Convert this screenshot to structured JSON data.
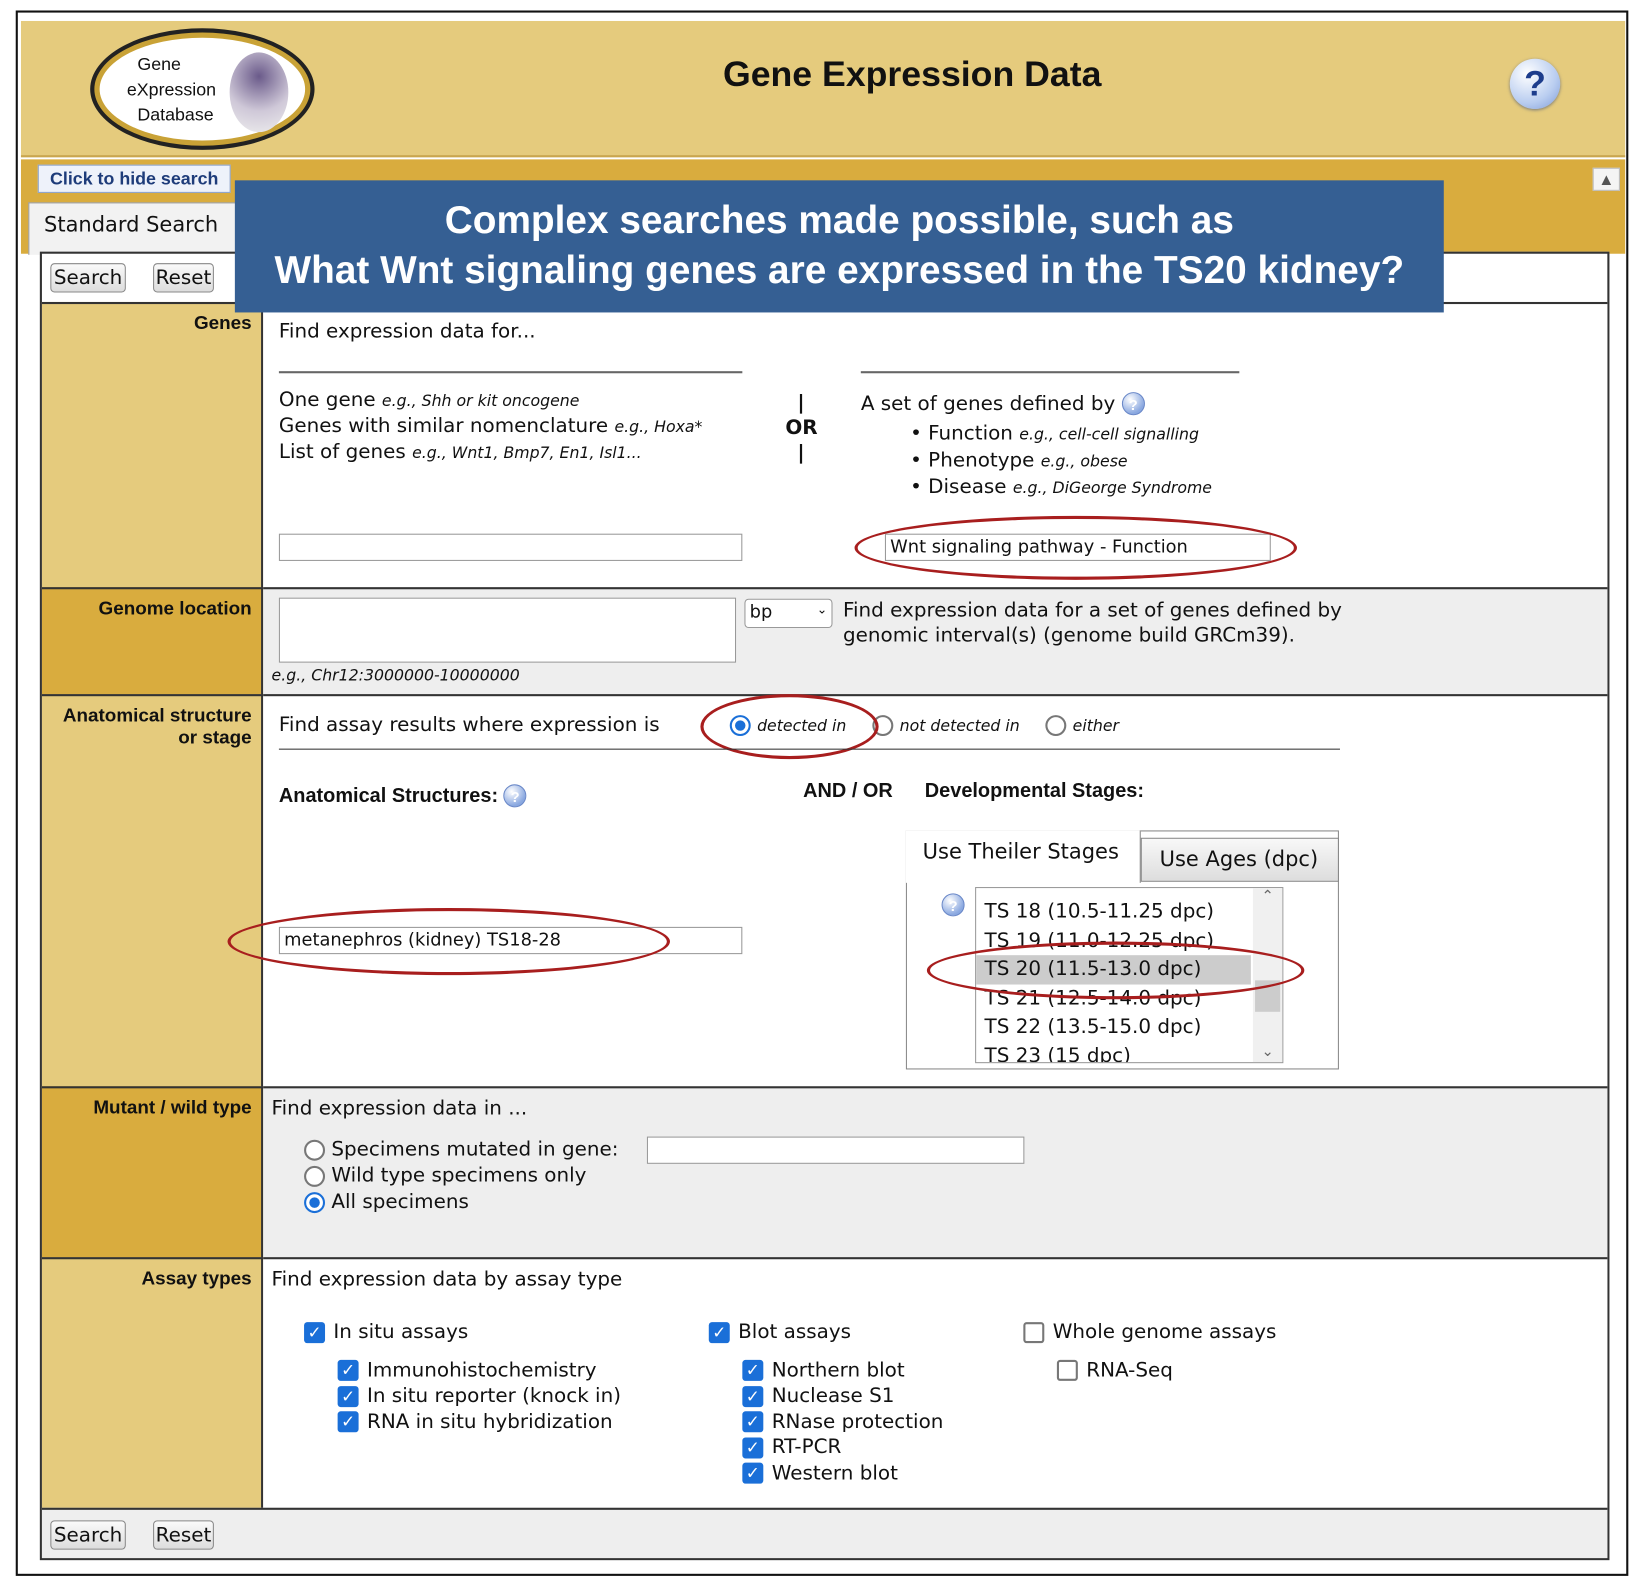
{
  "header": {
    "title": "Gene Expression Data",
    "logo_lines": [
      "Gene",
      "eXpression",
      "Database"
    ],
    "help": "?"
  },
  "controls": {
    "hide_search": "Click to hide search",
    "scroll_up": "^",
    "tab": "Standard Search",
    "search": "Search",
    "reset": "Reset"
  },
  "banner": {
    "line1": "Complex searches made possible, such as",
    "line2": "What Wnt signaling genes are expressed in the TS20 kidney?"
  },
  "genes": {
    "label": "Genes",
    "intro": "Find expression data for...",
    "one_gene": "One gene",
    "one_gene_eg": "e.g., Shh or kit oncogene",
    "similar": "Genes with similar nomenclature",
    "similar_eg": "e.g., Hoxa*",
    "list": "List of genes",
    "list_eg": "e.g., Wnt1, Bmp7, En1, Isl1...",
    "or": "OR",
    "bar": "|",
    "set_title": "A set of genes defined by",
    "bullets": [
      {
        "term": "Function",
        "eg": "e.g., cell-cell signalling"
      },
      {
        "term": "Phenotype",
        "eg": "e.g., obese"
      },
      {
        "term": "Disease",
        "eg": "e.g., DiGeorge Syndrome"
      }
    ],
    "gene_input": "",
    "set_input": "Wnt signaling pathway - Function"
  },
  "genome": {
    "label": "Genome location",
    "unit": "bp",
    "desc1": "Find expression data for a set of genes defined by",
    "desc2": "genomic interval(s) (genome build GRCm39).",
    "eg": "e.g., Chr12:3000000-10000000"
  },
  "anatomy": {
    "label1": "Anatomical structure",
    "label2": "or stage",
    "find": "Find assay results where expression is",
    "detected": "detected in",
    "not_detected": "not detected in",
    "either": "either",
    "structures_label": "Anatomical Structures:",
    "andor": "AND / OR",
    "stages_label": "Developmental Stages:",
    "structure_value": "metanephros (kidney) TS18-28",
    "tab_theiler": "Use Theiler Stages",
    "tab_ages": "Use Ages (dpc)",
    "stages": [
      "TS 18 (10.5-11.25 dpc)",
      "TS 19 (11.0-12.25 dpc)",
      "TS 20 (11.5-13.0 dpc)",
      "TS 21 (12.5-14.0 dpc)",
      "TS 22 (13.5-15.0 dpc)",
      "TS 23 (15 dpc)"
    ],
    "selected_stage": "TS 20 (11.5-13.0 dpc)"
  },
  "mutant": {
    "label": "Mutant / wild type",
    "intro": "Find expression data in ...",
    "opt1": "Specimens mutated in gene:",
    "opt2": "Wild type specimens only",
    "opt3": "All specimens",
    "selected": "All specimens",
    "gene_input": ""
  },
  "assay": {
    "label": "Assay types",
    "intro": "Find expression data by assay type",
    "groups": [
      {
        "name": "In situ assays",
        "checked": true,
        "items": [
          {
            "name": "Immunohistochemistry",
            "checked": true
          },
          {
            "name": "In situ reporter (knock in)",
            "checked": true
          },
          {
            "name": "RNA in situ hybridization",
            "checked": true
          }
        ]
      },
      {
        "name": "Blot assays",
        "checked": true,
        "items": [
          {
            "name": "Northern blot",
            "checked": true
          },
          {
            "name": "Nuclease S1",
            "checked": true
          },
          {
            "name": "RNase protection",
            "checked": true
          },
          {
            "name": "RT-PCR",
            "checked": true
          },
          {
            "name": "Western blot",
            "checked": true
          }
        ]
      },
      {
        "name": "Whole genome assays",
        "checked": false,
        "items": [
          {
            "name": "RNA-Seq",
            "checked": false
          }
        ]
      }
    ]
  },
  "colors": {
    "header": "#E5CB7D",
    "band": "#D9AC3E",
    "banner": "#355F93",
    "annotation": "#A81E1E",
    "accent": "#1a6fd8"
  }
}
